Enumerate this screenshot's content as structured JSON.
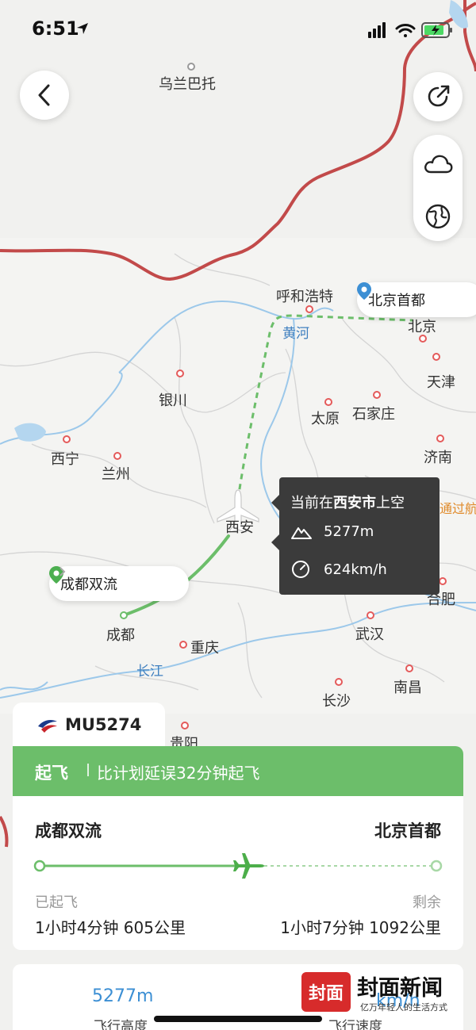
{
  "status_bar": {
    "time": "6:51",
    "icons": [
      "location-arrow-icon",
      "signal-icon",
      "wifi-icon",
      "battery-charging-icon"
    ]
  },
  "map": {
    "cities": [
      {
        "id": "wulanbatuo",
        "name": "乌兰巴托"
      },
      {
        "id": "huhehaote",
        "name": "呼和浩特"
      },
      {
        "id": "beijing",
        "name": "北京"
      },
      {
        "id": "tianjin",
        "name": "天津"
      },
      {
        "id": "yinchuan",
        "name": "银川"
      },
      {
        "id": "taiyuan",
        "name": "太原"
      },
      {
        "id": "shijiazhuang",
        "name": "石家庄"
      },
      {
        "id": "xining",
        "name": "西宁"
      },
      {
        "id": "lanzhou",
        "name": "兰州"
      },
      {
        "id": "jinan",
        "name": "济南"
      },
      {
        "id": "xian",
        "name": "西安"
      },
      {
        "id": "hefei",
        "name": "合肥"
      },
      {
        "id": "chengdu",
        "name": "成都"
      },
      {
        "id": "chongqing",
        "name": "重庆"
      },
      {
        "id": "wuhan",
        "name": "武汉"
      },
      {
        "id": "nanchang",
        "name": "南昌"
      },
      {
        "id": "changsha",
        "name": "长沙"
      },
      {
        "id": "guiyang",
        "name": "贵阳"
      }
    ],
    "rivers": [
      {
        "id": "huanghe",
        "name": "黄河"
      },
      {
        "id": "changjiang",
        "name": "长江"
      }
    ],
    "origin_airport": "成都双流",
    "destination_airport": "北京首都"
  },
  "flight_tip": {
    "position_prefix": "当前在",
    "position_city": "西安市",
    "position_suffix": "上空",
    "altitude": "5277m",
    "speed": "624km/h",
    "overflow_text": "通过航"
  },
  "flight": {
    "number": "MU5274",
    "state": "起飞",
    "delay_text": "比计划延误32分钟起飞",
    "departure": "成都双流",
    "arrival": "北京首都",
    "progress": 0.53,
    "elapsed_label": "已起飞",
    "elapsed_value": "1小时4分钟 605公里",
    "remaining_label": "剩余",
    "remaining_value": "1小时7分钟 1092公里"
  },
  "stats": {
    "altitude_value": "5277m",
    "altitude_label": "飞行高度",
    "speed_value": "km/h",
    "speed_label": "飞行速度"
  },
  "watermark": {
    "badge": "封面",
    "name": "封面新闻",
    "slogan": "亿万年轻人的生活方式"
  },
  "colors": {
    "route_green": "#6cbe6a",
    "border_red": "#c24a4a",
    "city_dot": "#e45a5a",
    "river_blue": "#3f7fbf",
    "accent_blue": "#3c8fd4",
    "tip_bg": "#3b3b3b"
  }
}
